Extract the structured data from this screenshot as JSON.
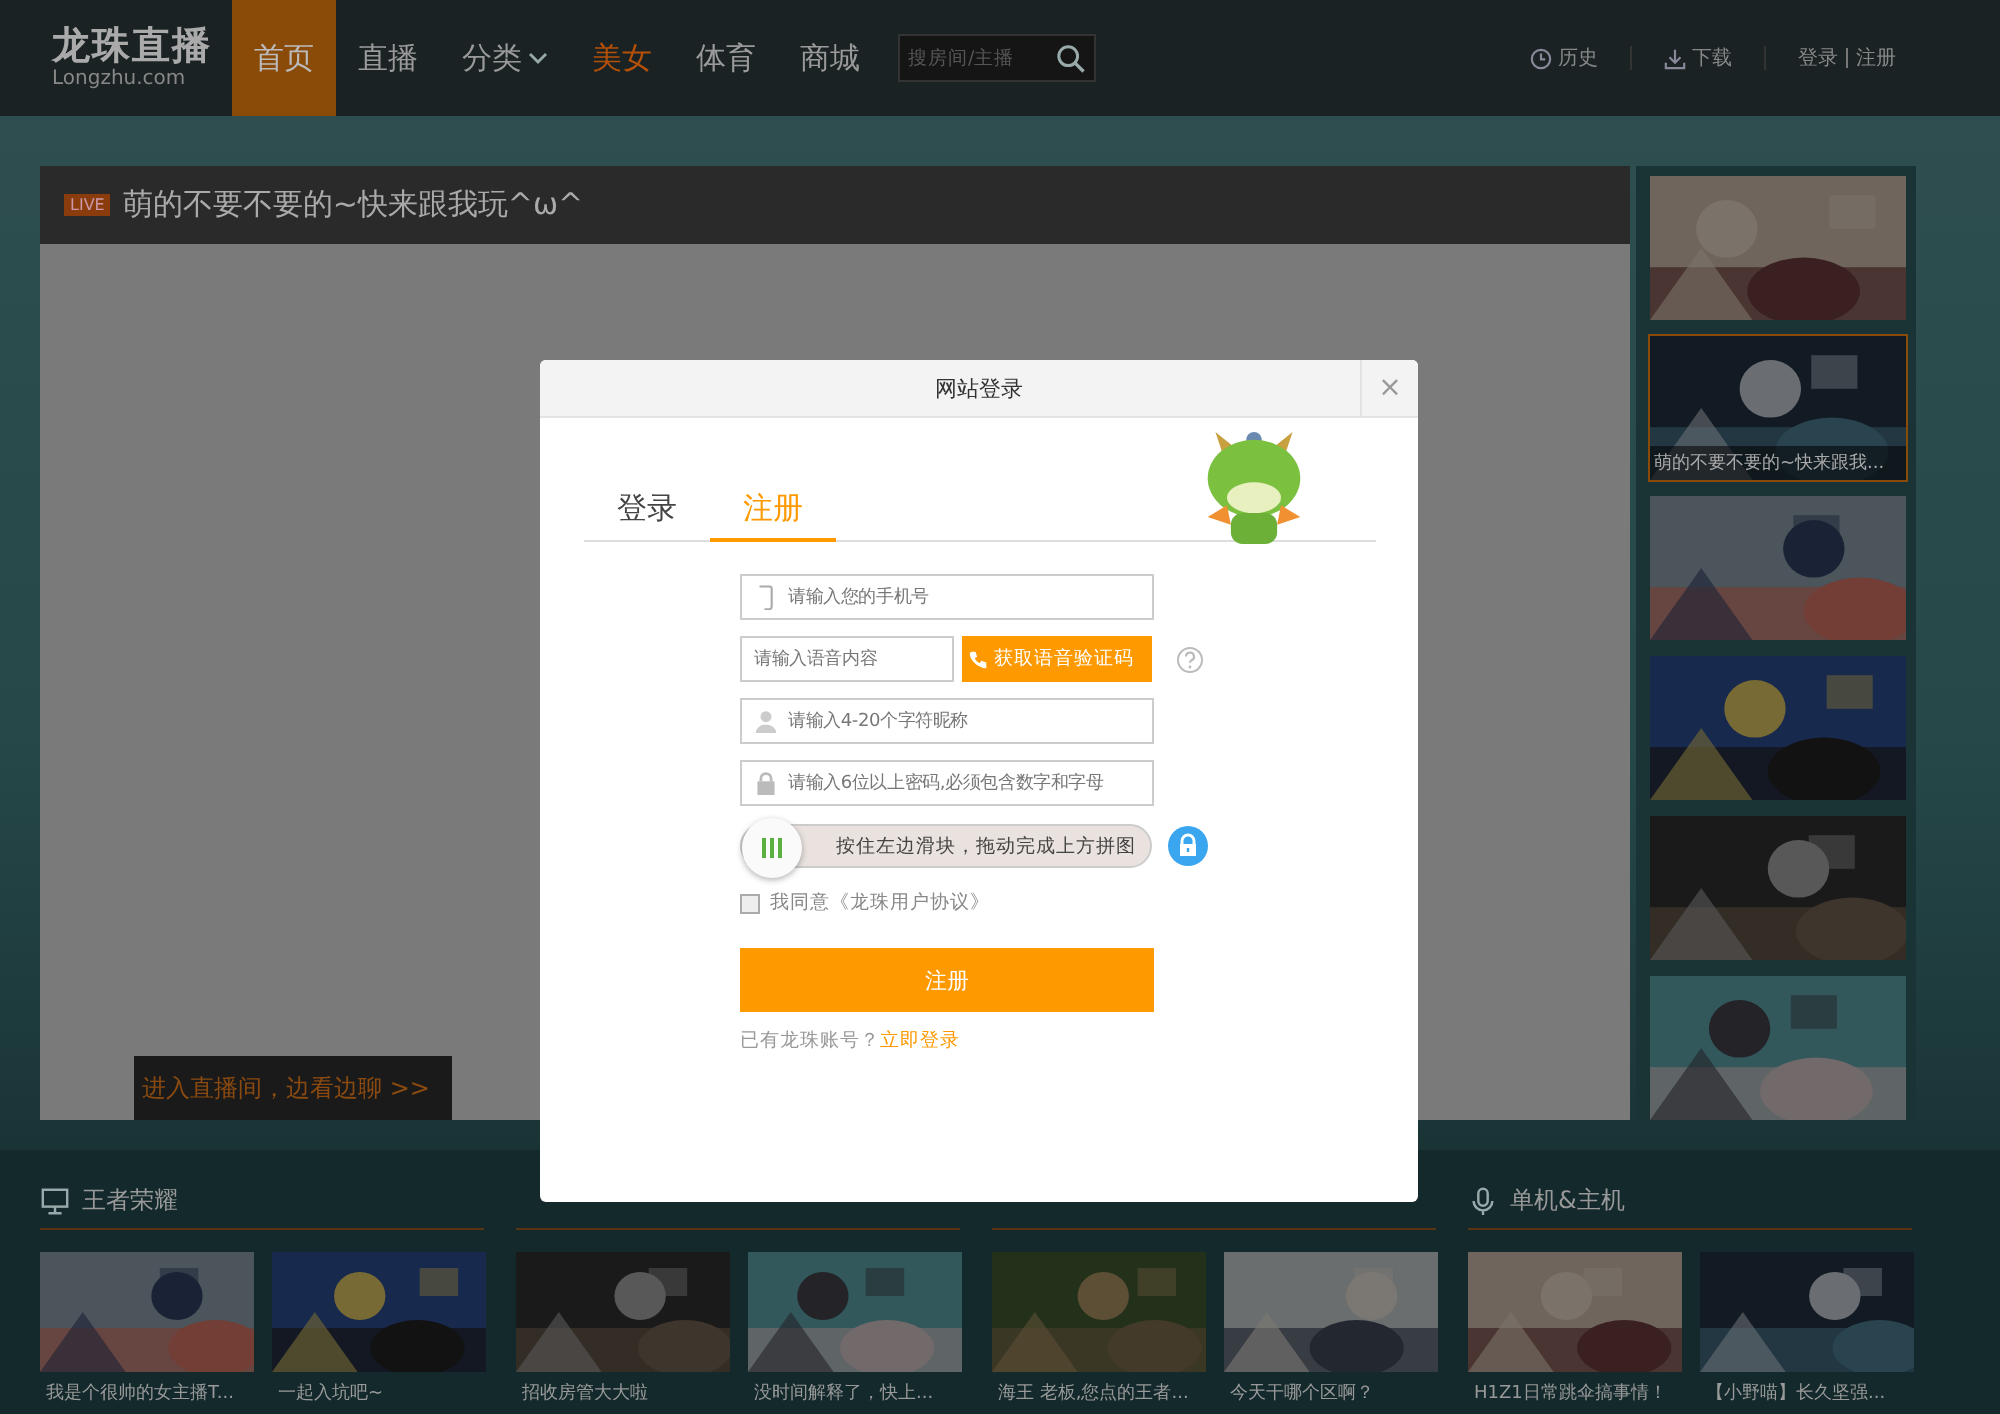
{
  "header": {
    "logo": "龙珠直播",
    "logo_sub": "Longzhu.com",
    "nav": [
      {
        "label": "首页",
        "selected": true,
        "dropdown": false,
        "hot": false
      },
      {
        "label": "直播",
        "selected": false,
        "dropdown": false,
        "hot": false
      },
      {
        "label": "分类",
        "selected": false,
        "dropdown": true,
        "hot": false
      },
      {
        "label": "美女",
        "selected": false,
        "dropdown": false,
        "hot": true
      },
      {
        "label": "体育",
        "selected": false,
        "dropdown": false,
        "hot": false
      },
      {
        "label": "商城",
        "selected": false,
        "dropdown": false,
        "hot": false
      }
    ],
    "search": {
      "placeholder": "搜房间/主播"
    },
    "history": "历史",
    "download": "下载",
    "login": "登录",
    "register": "注册"
  },
  "player": {
    "live_badge": "LIVE",
    "title": "萌的不要不要的~快来跟我玩^ω^",
    "enter_link": "进入直播间，边看边聊 >>"
  },
  "side_thumbs": [
    {
      "selected": false
    },
    {
      "selected": true,
      "caption": "萌的不要不要的~快来跟我..."
    },
    {
      "selected": false
    },
    {
      "selected": false
    },
    {
      "selected": false
    },
    {
      "selected": false
    }
  ],
  "sections": [
    {
      "kind": "monitor",
      "title": "王者荣耀",
      "items": [
        {
          "caption": "我是个很帅的女主播T..."
        },
        {
          "caption": "一起入坑吧~"
        }
      ]
    },
    {
      "items": [
        {
          "caption": "招收房管大大啦"
        },
        {
          "caption": "没时间解释了，快上..."
        }
      ]
    },
    {
      "items": [
        {
          "caption": "海王 老板,您点的王者..."
        },
        {
          "caption": "今天干哪个区啊？"
        }
      ]
    },
    {
      "kind": "mic",
      "title": "单机&主机",
      "items": [
        {
          "caption": "H1Z1日常跳伞搞事情！"
        },
        {
          "caption": "【小野喵】长久坚强..."
        }
      ]
    }
  ],
  "modal": {
    "title": "网站登录",
    "close": "×",
    "tabs": [
      {
        "label": "登录",
        "selected": false
      },
      {
        "label": "注册",
        "selected": true
      }
    ],
    "phone": {
      "kind": "phone",
      "placeholder": "请输入您的手机号"
    },
    "voice": {
      "placeholder": "请输入语音内容",
      "button": "获取语音验证码"
    },
    "nickname": {
      "kind": "user",
      "placeholder": "请输入4-20个字符昵称"
    },
    "password": {
      "kind": "lock",
      "placeholder": "请输入6位以上密码,必须包含数字和字母"
    },
    "slider": {
      "text": "按住左边滑块，拖动完成上方拼图"
    },
    "agree": {
      "checked": false,
      "text": "我同意《龙珠用户协议》"
    },
    "submit": "注册",
    "footer_text": "已有龙珠账号？",
    "footer_link": "立即登录"
  }
}
